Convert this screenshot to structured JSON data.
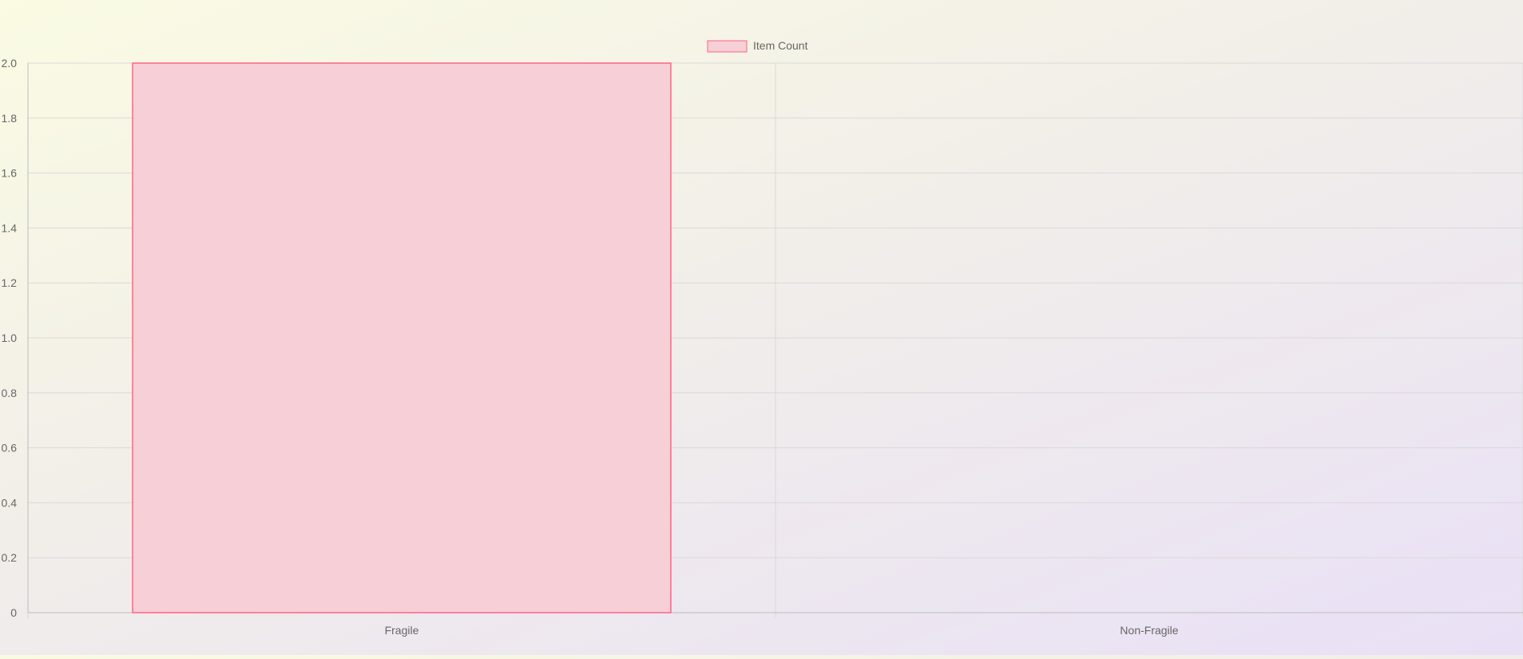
{
  "chart_data": {
    "type": "bar",
    "categories": [
      "Fragile",
      "Non-Fragile"
    ],
    "series": [
      {
        "name": "Item Count",
        "values": [
          2,
          0
        ],
        "fill": "#f7cfd6",
        "stroke": "#ff6384"
      }
    ],
    "title": "",
    "xlabel": "",
    "ylabel": "",
    "ylim": [
      0,
      2
    ],
    "yticks": [
      "0",
      "0.2",
      "0.4",
      "0.6",
      "0.8",
      "1.0",
      "1.2",
      "1.4",
      "1.6",
      "1.8",
      "2.0"
    ],
    "grid": true,
    "legend_position": "top-center"
  },
  "colors": {
    "grid": "#d9d9d9",
    "axis": "#bdbdbd",
    "text": "#666666"
  }
}
